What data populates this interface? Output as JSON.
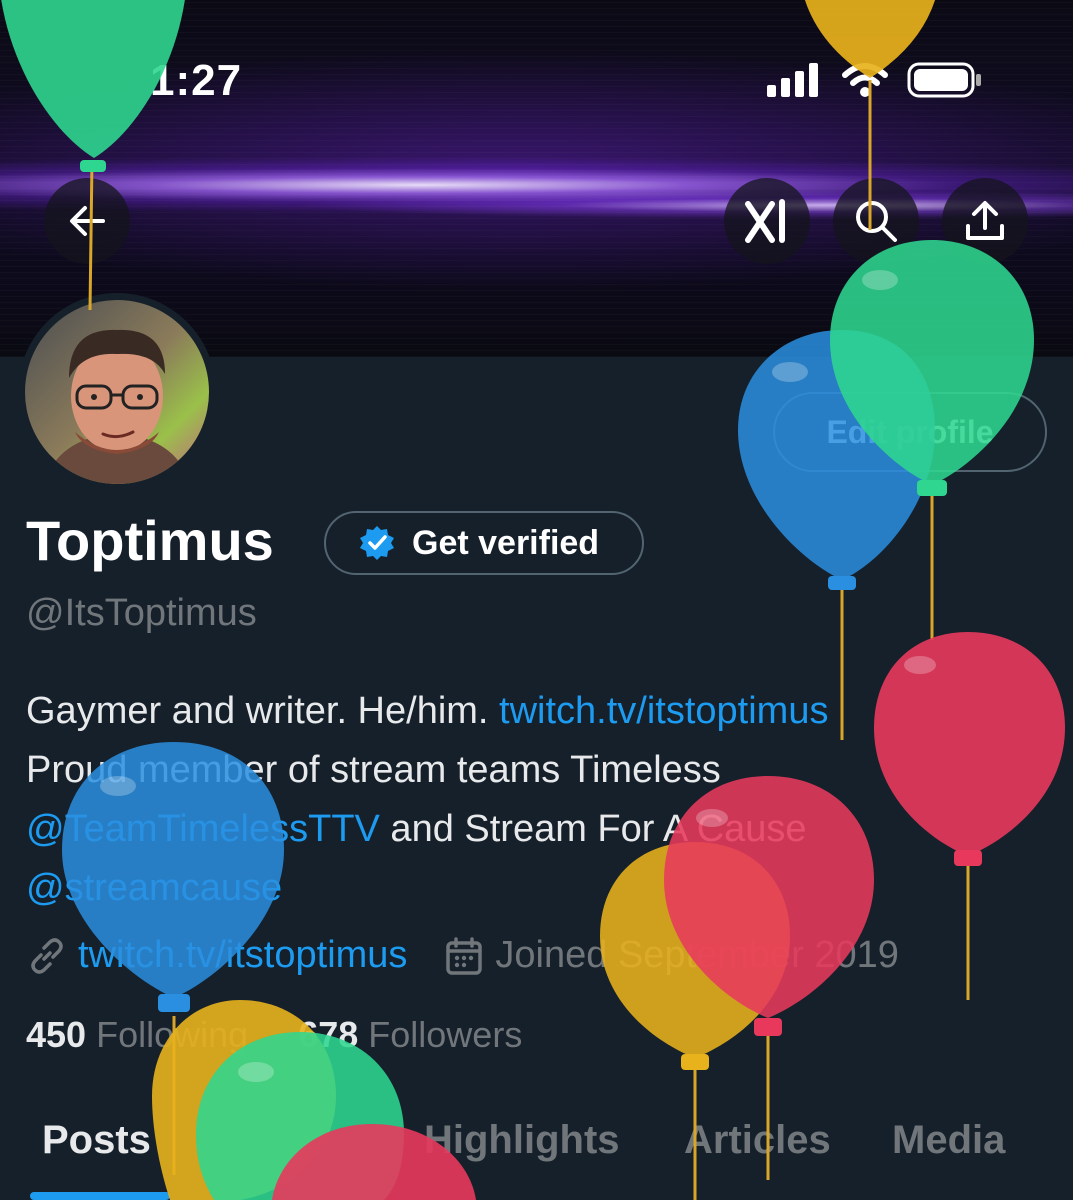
{
  "status_bar": {
    "time": "1:27"
  },
  "header": {
    "back_icon": "arrow-left-icon",
    "grok_icon": "grok-icon",
    "search_icon": "search-icon",
    "share_icon": "share-icon"
  },
  "profile": {
    "edit_label": "Edit profile",
    "name": "Toptimus",
    "verify_label": "Get verified",
    "handle": "@ItsToptimus",
    "bio": {
      "t1": "Gaymer and writer. He/him. ",
      "link1": "twitch.tv/itstoptimus",
      "t2": "Proud member of stream teams Timeless",
      "mention1": "@TeamTimelessTTV",
      "t3": " and Stream For A Cause",
      "mention2": "@streamcause"
    },
    "website": "twitch.tv/itstoptimus",
    "joined": "Joined September 2019",
    "following_count": "450",
    "following_label": "Following",
    "followers_count": "678",
    "followers_label": "Followers"
  },
  "tabs": [
    {
      "label": "Posts",
      "active": true
    },
    {
      "label": "Highlights"
    },
    {
      "label": "Articles"
    },
    {
      "label": "Media"
    }
  ],
  "colors": {
    "accent": "#1d9bf0",
    "background": "#15202b",
    "muted": "#71767b"
  }
}
